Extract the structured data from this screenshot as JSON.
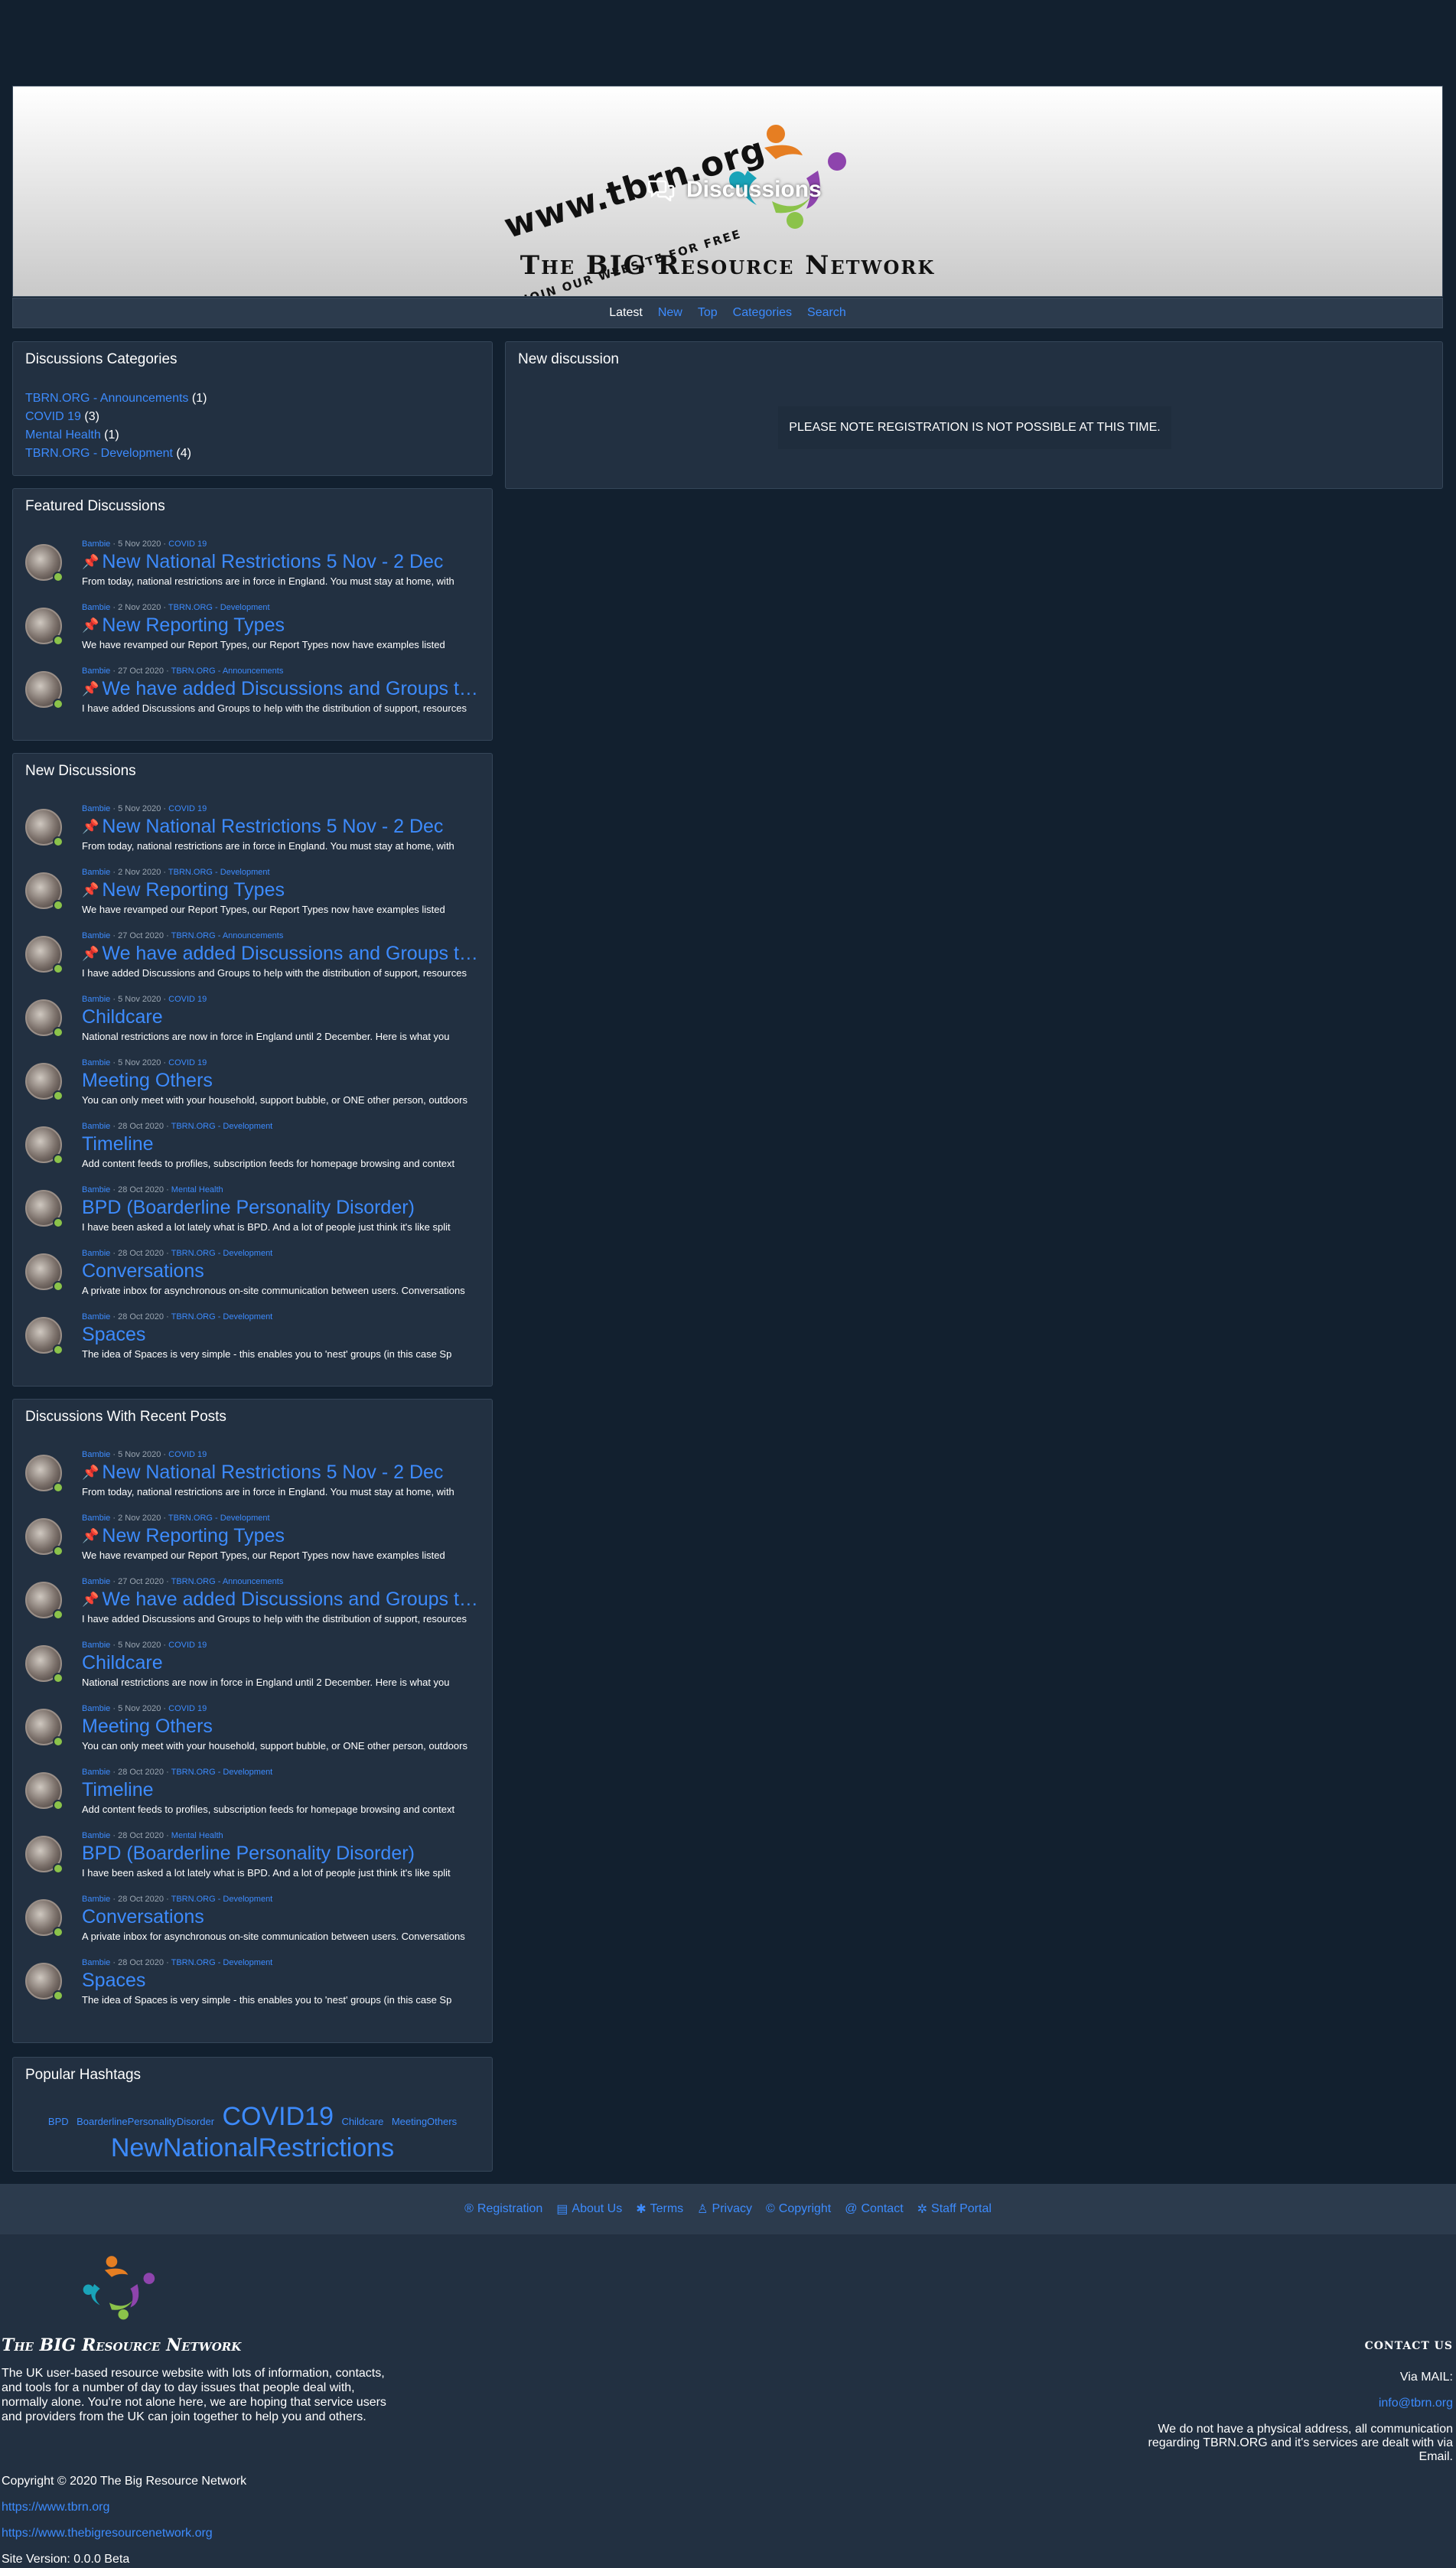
{
  "banner": {
    "url_text": "www.tbrn.org",
    "join_text": "JOIN OUR WEBSITE FOR FREE",
    "discussions_label": "Discussions",
    "title": "The BIG Resource Network"
  },
  "nav": {
    "items": [
      "Latest",
      "New",
      "Top",
      "Categories",
      "Search"
    ]
  },
  "categories": {
    "title": "Discussions Categories",
    "items": [
      {
        "name": "TBRN.ORG - Announcements",
        "count": "(1)"
      },
      {
        "name": "COVID 19",
        "count": "(3)"
      },
      {
        "name": "Mental Health",
        "count": "(1)"
      },
      {
        "name": "TBRN.ORG - Development",
        "count": "(4)"
      }
    ]
  },
  "new_discussion": {
    "title": "New discussion",
    "notice": "PLEASE NOTE REGISTRATION IS NOT POSSIBLE AT THIS TIME."
  },
  "featured": {
    "title": "Featured Discussions",
    "items": [
      {
        "author": "Bambie",
        "date": "5 Nov 2020",
        "category": "COVID 19",
        "title": "New National Restrictions 5 Nov - 2 Dec",
        "excerpt": "From today, national restrictions are in force in England. You must stay at home, with"
      },
      {
        "author": "Bambie",
        "date": "2 Nov 2020",
        "category": "TBRN.ORG - Development",
        "title": "New Reporting Types",
        "excerpt": "We have revamped our Report Types, our Report Types now have examples listed"
      },
      {
        "author": "Bambie",
        "date": "27 Oct 2020",
        "category": "TBRN.ORG - Announcements",
        "title": "We have added Discussions and Groups to the",
        "excerpt": "I have added Discussions and Groups to help with the distribution of support, resources"
      }
    ]
  },
  "new_discussions": {
    "title": "New Discussions",
    "items": [
      {
        "author": "Bambie",
        "date": "5 Nov 2020",
        "category": "COVID 19",
        "title": "New National Restrictions 5 Nov - 2 Dec",
        "excerpt": "From today, national restrictions are in force in England. You must stay at home, with"
      },
      {
        "author": "Bambie",
        "date": "2 Nov 2020",
        "category": "TBRN.ORG - Development",
        "title": "New Reporting Types",
        "excerpt": "We have revamped our Report Types, our Report Types now have examples listed"
      },
      {
        "author": "Bambie",
        "date": "27 Oct 2020",
        "category": "TBRN.ORG - Announcements",
        "title": "We have added Discussions and Groups to the",
        "excerpt": "I have added Discussions and Groups to help with the distribution of support, resources"
      },
      {
        "author": "Bambie",
        "date": "5 Nov 2020",
        "category": "COVID 19",
        "title": "Childcare",
        "excerpt": "National restrictions are now in force in England until 2 December. Here is what you"
      },
      {
        "author": "Bambie",
        "date": "5 Nov 2020",
        "category": "COVID 19",
        "title": "Meeting Others",
        "excerpt": "You can only meet with your household, support bubble, or ONE other person, outdoors"
      },
      {
        "author": "Bambie",
        "date": "28 Oct 2020",
        "category": "TBRN.ORG - Development",
        "title": "Timeline",
        "excerpt": "Add content feeds to profiles, subscription feeds for homepage browsing and context"
      },
      {
        "author": "Bambie",
        "date": "28 Oct 2020",
        "category": "Mental Health",
        "title": "BPD (Boarderline Personality Disorder)",
        "excerpt": "I have been asked a lot lately what is BPD. And a lot of people just think it's like split"
      },
      {
        "author": "Bambie",
        "date": "28 Oct 2020",
        "category": "TBRN.ORG - Development",
        "title": "Conversations",
        "excerpt": "A private inbox for asynchronous on-site communication between users. Conversations"
      },
      {
        "author": "Bambie",
        "date": "28 Oct 2020",
        "category": "TBRN.ORG - Development",
        "title": "Spaces",
        "excerpt": "The idea of Spaces is very simple - this enables you to 'nest' groups (in this case Sp"
      }
    ]
  },
  "recent": {
    "title": "Discussions With Recent Posts",
    "items": [
      {
        "author": "Bambie",
        "date": "5 Nov 2020",
        "category": "COVID 19",
        "title": "New National Restrictions 5 Nov - 2 Dec",
        "excerpt": "From today, national restrictions are in force in England. You must stay at home, with"
      },
      {
        "author": "Bambie",
        "date": "2 Nov 2020",
        "category": "TBRN.ORG - Development",
        "title": "New Reporting Types",
        "excerpt": "We have revamped our Report Types, our Report Types now have examples listed"
      },
      {
        "author": "Bambie",
        "date": "27 Oct 2020",
        "category": "TBRN.ORG - Announcements",
        "title": "We have added Discussions and Groups to the",
        "excerpt": "I have added Discussions and Groups to help with the distribution of support, resources"
      },
      {
        "author": "Bambie",
        "date": "5 Nov 2020",
        "category": "COVID 19",
        "title": "Childcare",
        "excerpt": "National restrictions are now in force in England until 2 December. Here is what you"
      },
      {
        "author": "Bambie",
        "date": "5 Nov 2020",
        "category": "COVID 19",
        "title": "Meeting Others",
        "excerpt": "You can only meet with your household, support bubble, or ONE other person, outdoors"
      },
      {
        "author": "Bambie",
        "date": "28 Oct 2020",
        "category": "TBRN.ORG - Development",
        "title": "Timeline",
        "excerpt": "Add content feeds to profiles, subscription feeds for homepage browsing and context"
      },
      {
        "author": "Bambie",
        "date": "28 Oct 2020",
        "category": "Mental Health",
        "title": "BPD (Boarderline Personality Disorder)",
        "excerpt": "I have been asked a lot lately what is BPD. And a lot of people just think it's like split"
      },
      {
        "author": "Bambie",
        "date": "28 Oct 2020",
        "category": "TBRN.ORG - Development",
        "title": "Conversations",
        "excerpt": "A private inbox for asynchronous on-site communication between users. Conversations"
      },
      {
        "author": "Bambie",
        "date": "28 Oct 2020",
        "category": "TBRN.ORG - Development",
        "title": "Spaces",
        "excerpt": "The idea of Spaces is very simple - this enables you to 'nest' groups (in this case Sp"
      }
    ]
  },
  "hashtags": {
    "title": "Popular Hashtags",
    "tags": [
      {
        "text": "BPD",
        "size": "s"
      },
      {
        "text": "BoarderlinePersonalityDisorder",
        "size": "s"
      },
      {
        "text": "COVID19",
        "size": "l"
      },
      {
        "text": "Childcare",
        "size": "s"
      },
      {
        "text": "MeetingOthers",
        "size": "s"
      },
      {
        "text": "NewNationalRestrictions",
        "size": "l"
      }
    ]
  },
  "footer": {
    "links": [
      {
        "icon": "registration-icon",
        "glyph": "®",
        "label": "Registration"
      },
      {
        "icon": "about-icon",
        "glyph": "▤",
        "label": "About Us"
      },
      {
        "icon": "terms-icon",
        "glyph": "✱",
        "label": "Terms"
      },
      {
        "icon": "privacy-icon",
        "glyph": "♙",
        "label": "Privacy"
      },
      {
        "icon": "copyright-icon",
        "glyph": "©",
        "label": "Copyright"
      },
      {
        "icon": "contact-icon",
        "glyph": "@",
        "label": "Contact"
      },
      {
        "icon": "staff-icon",
        "glyph": "✲",
        "label": "Staff Portal"
      }
    ],
    "brand": "The BIG Resource Network",
    "about": "The UK user-based resource website with lots of information, contacts, and tools for a number of day to day issues that people deal with, normally alone. You're not alone here, we are hoping that service users and providers from the UK can join together to help you and others.",
    "copyright": "Copyright © 2020 The Big Resource Network",
    "url1": "https://www.tbrn.org",
    "url2": "https://www.thebigresourcenetwork.org",
    "version": "Site Version: 0.0.0 Beta",
    "contact_heading": "CONTACT US",
    "contact_via": "Via MAIL:",
    "contact_email": "info@tbrn.org",
    "contact_note": "We do not have a physical address, all communication regarding TBRN.ORG and it's services are dealt with via Email."
  },
  "colors": {
    "background": "#12202f",
    "panel": "#223041",
    "link": "#3d8bfd",
    "online": "#8bc34a"
  }
}
